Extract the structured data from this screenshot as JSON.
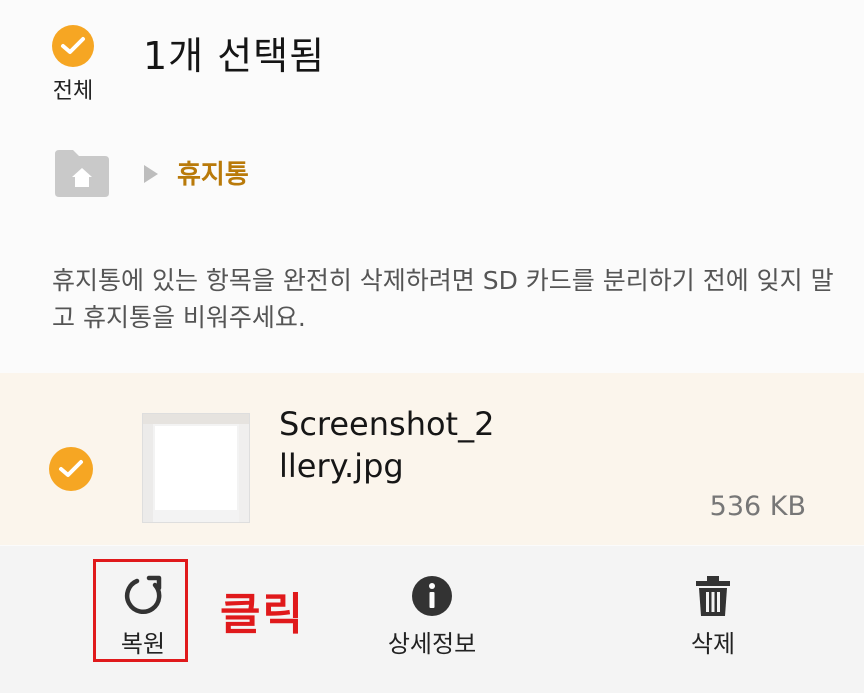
{
  "header": {
    "select_all_label": "전체",
    "title": "1개 선택됨"
  },
  "breadcrumb": {
    "home_icon": "folder-home-icon",
    "separator_icon": "triangle-right-icon",
    "current": "휴지통"
  },
  "notice": "휴지통에 있는 항목을 완전히 삭제하려면 SD 카드를 분리하기 전에 잊지 말고 휴지통을 비워주세요.",
  "file": {
    "selected": true,
    "name_line1": "Screenshot_2(",
    "name_line2": "llery.jpg",
    "size": "536 KB"
  },
  "actions": {
    "restore_label": "복원",
    "details_label": "상세정보",
    "delete_label": "삭제"
  },
  "annotation": {
    "click_note": "클릭"
  },
  "colors": {
    "accent": "#f6a623",
    "breadcrumb": "#b97a0a",
    "highlight": "#e0191b"
  }
}
